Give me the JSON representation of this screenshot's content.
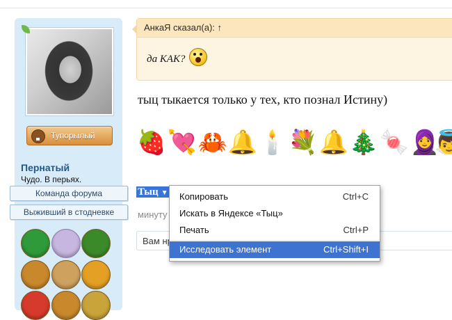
{
  "quote": {
    "author_line": "АнкаЯ сказал(а): ↑",
    "text": "да КАК?"
  },
  "post": {
    "text": "тыц тыкается только у тех, кто познал Истину)",
    "emojis": [
      "🍓",
      "💘",
      "🦀",
      "🔔",
      "🕯️",
      "💐",
      "🔔",
      "🎄",
      "🍬",
      "🧕",
      "👼"
    ]
  },
  "user": {
    "rank_badge": "Тупорылый",
    "name": "Пернатый",
    "title": "Чудо. В перьях.",
    "tags": [
      "Команда форума",
      "Выживший в стодневке"
    ]
  },
  "selection": {
    "word": "Тыц",
    "caret": "▼"
  },
  "meta": {
    "time_partial": "минуту"
  },
  "reply": {
    "text_partial": "Вам нр"
  },
  "context_menu": {
    "items": [
      {
        "label": "Копировать",
        "shortcut": "Ctrl+C"
      },
      {
        "label": "Искать в Яндексе «Тыц»",
        "shortcut": ""
      },
      {
        "label": "Печать",
        "shortcut": "Ctrl+P"
      },
      {
        "label": "Исследовать элемент",
        "shortcut": "Ctrl+Shift+I"
      }
    ],
    "active_index": 3,
    "accent_color": "#3e73d2"
  },
  "colors": {
    "sidebar_bg": "#d8ebf8",
    "username": "#21578c",
    "quote_bg": "#fdf5e2",
    "selection": "#3875d7"
  }
}
